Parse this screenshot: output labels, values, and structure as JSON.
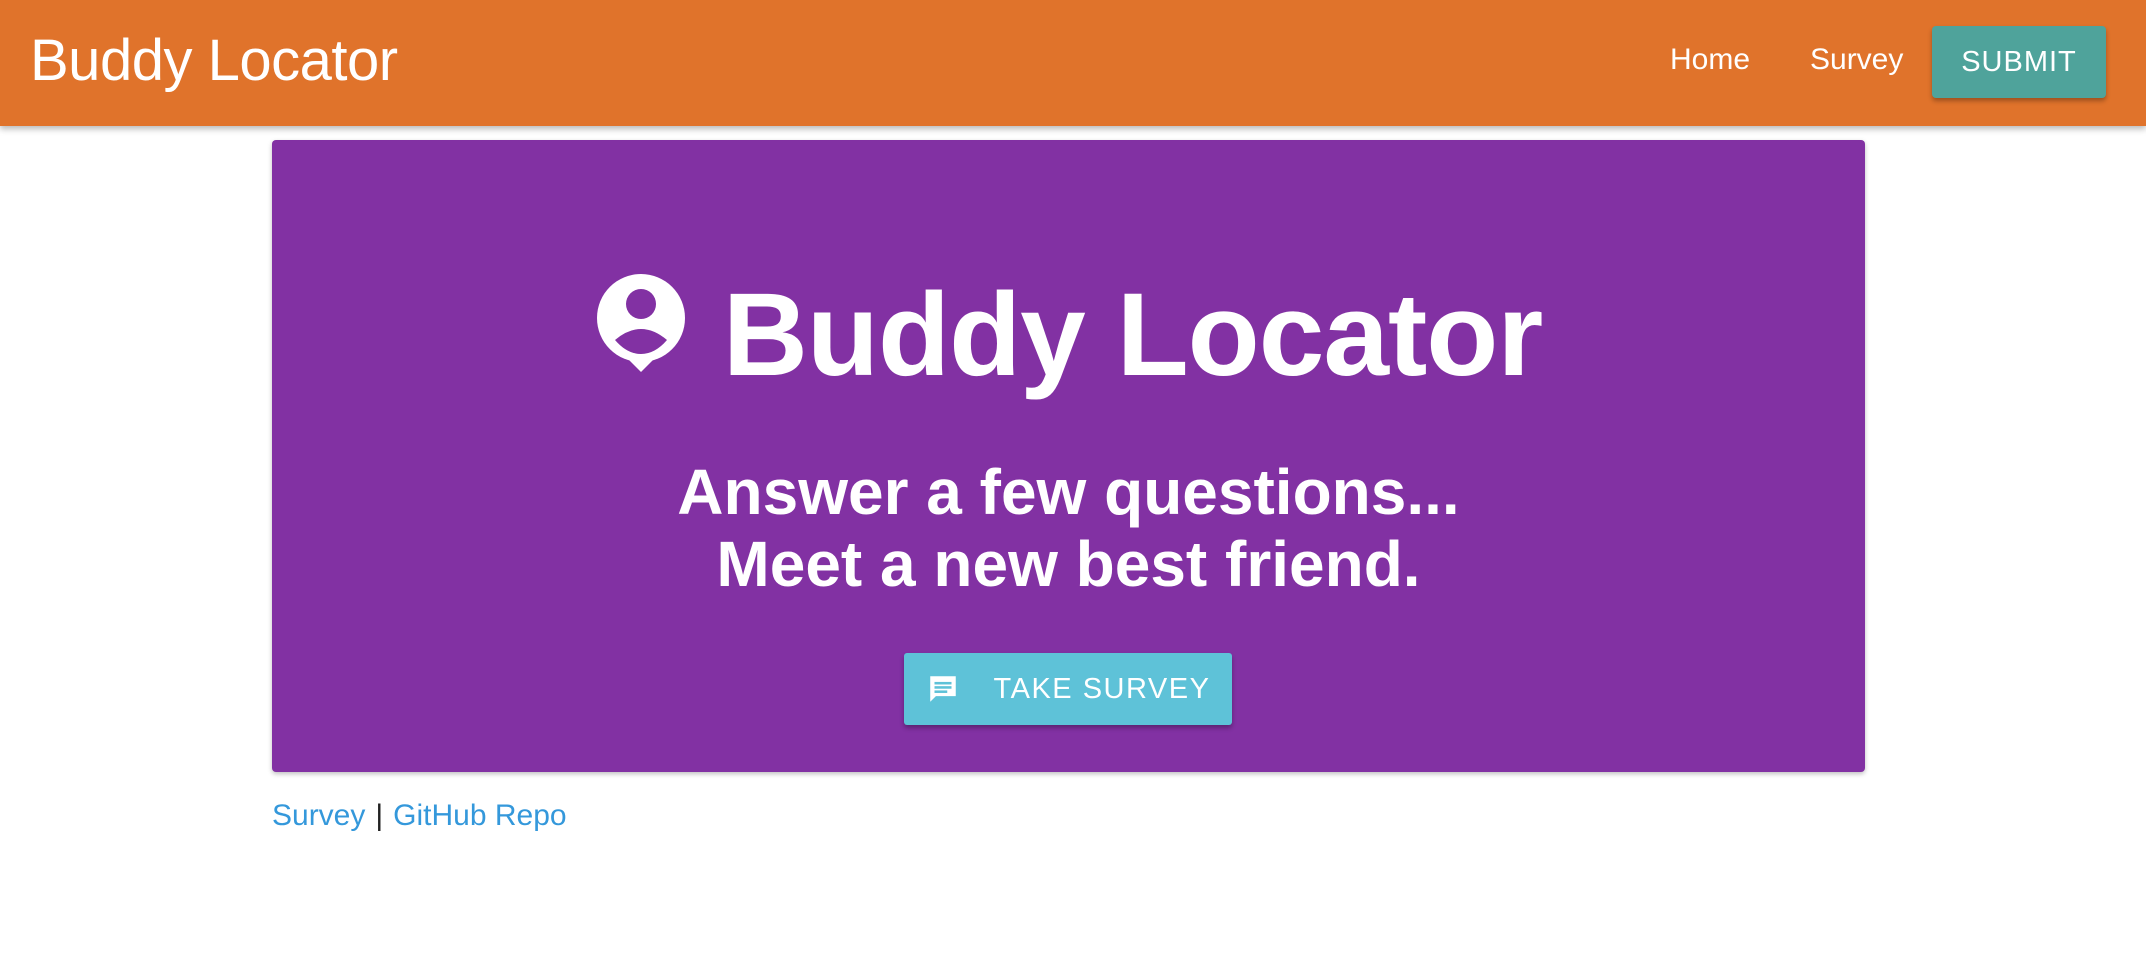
{
  "navbar": {
    "brand": "Buddy Locator",
    "links": [
      {
        "label": "Home"
      },
      {
        "label": "Survey"
      }
    ],
    "submit_label": "Submit",
    "colors": {
      "background": "#e0732b",
      "submit": "#4fa39b"
    }
  },
  "hero": {
    "icon": "person-pin-icon",
    "title": "Buddy Locator",
    "subtitle_line1": "Answer a few questions...",
    "subtitle_line2": "Meet a new best friend.",
    "button_icon": "chat-bubble-icon",
    "button_label": "Take Survey",
    "colors": {
      "background": "#8231a3",
      "button": "#5ec2d8"
    }
  },
  "footer": {
    "links": [
      {
        "label": "Survey"
      },
      {
        "label": "GitHub Repo"
      }
    ],
    "separator": "|",
    "link_color": "#3498db"
  }
}
